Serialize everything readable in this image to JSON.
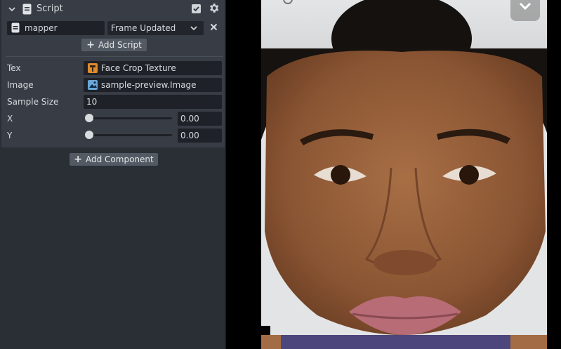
{
  "script_component": {
    "title": "Script",
    "enabled": true,
    "script_name": "mapper",
    "event": "Frame Updated",
    "add_script_label": "Add Script",
    "properties": {
      "tex": {
        "label": "Tex",
        "value": "Face Crop Texture"
      },
      "image": {
        "label": "Image",
        "value": "sample-preview.Image"
      },
      "sample_size": {
        "label": "Sample Size",
        "value": "10"
      },
      "x": {
        "label": "X",
        "value": "0.00",
        "slider_fraction": 0
      },
      "y": {
        "label": "Y",
        "value": "0.00",
        "slider_fraction": 0
      }
    }
  },
  "add_component_label": "Add Component",
  "icons": {
    "collapse": "chevron-down-icon",
    "script": "script-file-icon",
    "settings": "gear-icon",
    "remove": "close-icon",
    "texture": "texture-icon",
    "image": "image-icon",
    "preview_menu": "chevron-down-icon"
  },
  "colors": {
    "panel_bg": "#2a2e35",
    "section_bg": "#383c44",
    "field_bg": "#1e2127",
    "button_bg": "#545a63",
    "accent_texture": "#e08a2e",
    "accent_image": "#6aa7d8"
  }
}
